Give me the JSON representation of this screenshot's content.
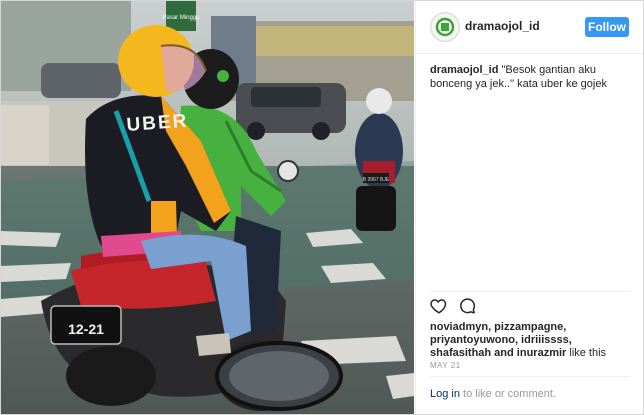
{
  "post": {
    "username": "dramaojol_id",
    "follow_label": "Follow",
    "caption_username": "dramaojol_id",
    "caption_text": "\"Besok gantian aku bonceng ya jek..\" kata uber ke gojek",
    "likes_text": "noviadmyn, pizzampagne, priyantoyuwono, idriiissss, shafasithah and inurazmir",
    "likes_suffix": "like this",
    "date": "MAY 21",
    "login_label": "Log in",
    "comment_text": "to like or comment."
  },
  "photo": {
    "jacket_text": "UBER",
    "plate_text": "12-21",
    "road_sign": "Pasar Minggu",
    "plate_right": "B 3967 BJE"
  },
  "icons": {
    "like": "heart-icon",
    "comment": "comment-icon",
    "avatar": "avatar"
  },
  "colors": {
    "follow_button": "#3897f0",
    "helmet_yellow": "#f4b71d",
    "jacket_green": "#46b13e",
    "link_blue": "#003569"
  }
}
